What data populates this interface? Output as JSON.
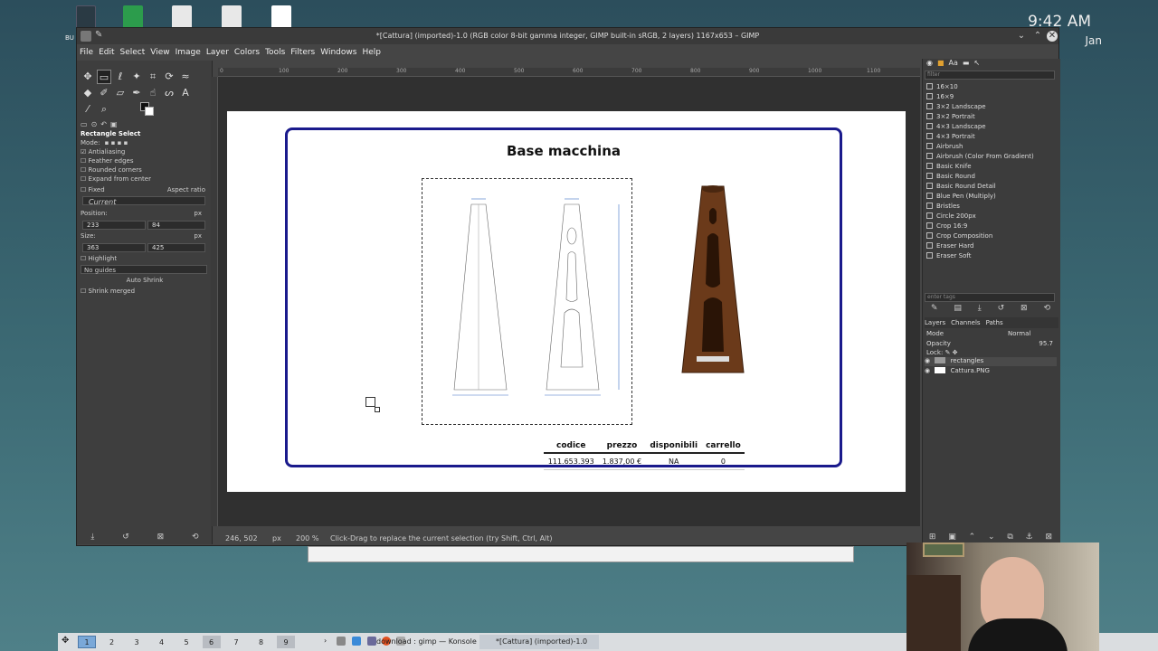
{
  "desktop": {
    "clock": "9:42 AM",
    "date": "Jan",
    "icon_label": "BU"
  },
  "gimp": {
    "window_title": "*[Cattura] (imported)-1.0 (RGB color 8-bit gamma integer, GIMP built-in sRGB, 2 layers) 1167x653 – GIMP",
    "menus": [
      "File",
      "Edit",
      "Select",
      "View",
      "Image",
      "Layer",
      "Colors",
      "Tools",
      "Filters",
      "Windows",
      "Help"
    ],
    "ruler_labels": [
      "0",
      "100",
      "200",
      "300",
      "400",
      "500",
      "600",
      "700",
      "800",
      "900",
      "1000",
      "1100"
    ],
    "tool_options": {
      "title": "Rectangle Select",
      "mode_label": "Mode:",
      "antialiasing": "Antialiasing",
      "feather_edges": "Feather edges",
      "rounded_corners": "Rounded corners",
      "expand_from_center": "Expand from center",
      "fixed_label": "Fixed",
      "fixed_value": "Aspect ratio",
      "current": "Current",
      "position_label": "Position:",
      "position_unit": "px",
      "position_x": "233",
      "position_y": "84",
      "size_label": "Size:",
      "size_unit": "px",
      "size_w": "363",
      "size_h": "425",
      "highlight": "Highlight",
      "guides": "No guides",
      "auto_shrink": "Auto Shrink",
      "shrink_merged": "Shrink merged"
    },
    "status": {
      "coords": "246, 502",
      "unit": "px",
      "zoom": "200 %",
      "message": "Click-Drag to replace the current selection (try Shift, Ctrl, Alt)"
    },
    "image": {
      "title": "Base macchina",
      "table_headers": [
        "codice",
        "prezzo",
        "disponibili",
        "carrello"
      ],
      "table_row": [
        "111.653.393",
        "1.837,00 €",
        "NA",
        "0"
      ]
    },
    "brushes_filter": "filter",
    "brushes": [
      "16×10",
      "16×9",
      "3×2 Landscape",
      "3×2 Portrait",
      "4×3 Landscape",
      "4×3 Portrait",
      "Airbrush",
      "Airbrush (Color From Gradient)",
      "Basic Knife",
      "Basic Round",
      "Basic Round Detail",
      "Blue Pen (Multiply)",
      "Bristles",
      "Circle 200px",
      "Crop 16:9",
      "Crop Composition",
      "Eraser Hard",
      "Eraser Soft"
    ],
    "enter_tags": "enter tags",
    "layers_tabs": [
      "Layers",
      "Channels",
      "Paths"
    ],
    "layers": {
      "mode_label": "Mode",
      "mode_value": "Normal",
      "opacity_label": "Opacity",
      "opacity_value": "95.7",
      "lock_label": "Lock:",
      "items": [
        "rectangles",
        "Cattura.PNG"
      ]
    }
  },
  "taskbar": {
    "workspaces": [
      "1",
      "2",
      "3",
      "4",
      "5",
      "6",
      "7",
      "8",
      "9"
    ],
    "tasks": [
      "download : gimp — Konsole",
      "*[Cattura] (imported)-1.0 (R..."
    ]
  }
}
